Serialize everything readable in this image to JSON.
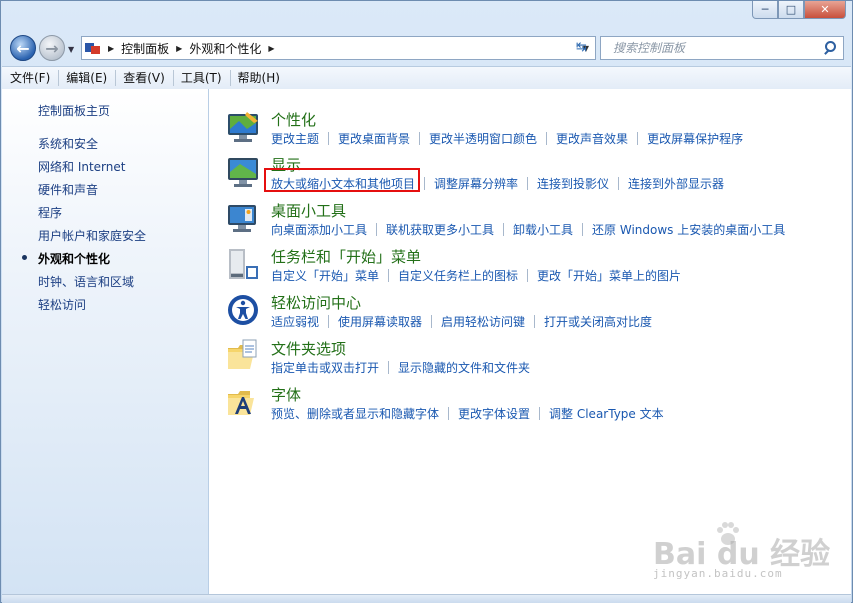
{
  "window": {
    "min_label": "─",
    "max_label": "□",
    "close_label": "✕"
  },
  "nav": {
    "back_icon": "back-arrow-icon",
    "forward_icon": "forward-arrow-icon",
    "breadcrumb": [
      "控制面板",
      "外观和个性化"
    ],
    "search_placeholder": "搜索控制面板"
  },
  "menu": [
    "文件(F)",
    "编辑(E)",
    "查看(V)",
    "工具(T)",
    "帮助(H)"
  ],
  "sidebar": {
    "items": [
      {
        "label": "控制面板主页",
        "active": false
      },
      {
        "label": "系统和安全",
        "active": false
      },
      {
        "label": "网络和 Internet",
        "active": false
      },
      {
        "label": "硬件和声音",
        "active": false
      },
      {
        "label": "程序",
        "active": false
      },
      {
        "label": "用户帐户和家庭安全",
        "active": false
      },
      {
        "label": "外观和个性化",
        "active": true
      },
      {
        "label": "时钟、语言和区域",
        "active": false
      },
      {
        "label": "轻松访问",
        "active": false
      }
    ]
  },
  "categories": [
    {
      "title": "个性化",
      "icon": "personalization-icon",
      "links": [
        "更改主题",
        "更改桌面背景",
        "更改半透明窗口颜色",
        "更改声音效果",
        "更改屏幕保护程序"
      ]
    },
    {
      "title": "显示",
      "icon": "display-icon",
      "links": [
        "放大或缩小文本和其他项目",
        "调整屏幕分辨率",
        "连接到投影仪",
        "连接到外部显示器"
      ]
    },
    {
      "title": "桌面小工具",
      "icon": "gadgets-icon",
      "links": [
        "向桌面添加小工具",
        "联机获取更多小工具",
        "卸载小工具",
        "还原 Windows 上安装的桌面小工具"
      ]
    },
    {
      "title": "任务栏和「开始」菜单",
      "icon": "taskbar-icon",
      "links": [
        "自定义「开始」菜单",
        "自定义任务栏上的图标",
        "更改「开始」菜单上的图片"
      ]
    },
    {
      "title": "轻松访问中心",
      "icon": "ease-of-access-icon",
      "links": [
        "适应弱视",
        "使用屏幕读取器",
        "启用轻松访问键",
        "打开或关闭高对比度"
      ]
    },
    {
      "title": "文件夹选项",
      "icon": "folder-options-icon",
      "links": [
        "指定单击或双击打开",
        "显示隐藏的文件和文件夹"
      ]
    },
    {
      "title": "字体",
      "icon": "fonts-icon",
      "links": [
        "预览、删除或者显示和隐藏字体",
        "更改字体设置",
        "调整 ClearType 文本"
      ]
    }
  ],
  "highlight": {
    "target": "放大或缩小文本和其他项目",
    "color": "#e50f0f"
  },
  "watermark": {
    "main": "Bai du 经验",
    "sub": "jingyan.baidu.com"
  },
  "colors": {
    "link": "#1a58b0",
    "category_title": "#237018",
    "sidebar_link": "#1c3f83"
  }
}
